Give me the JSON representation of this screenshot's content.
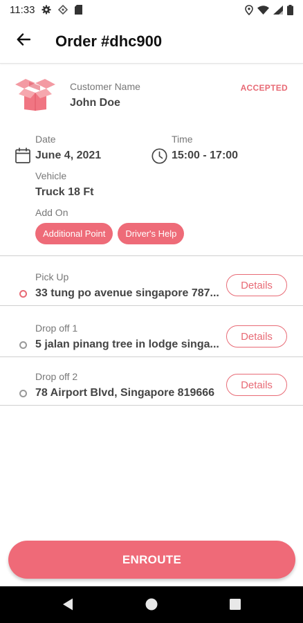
{
  "status_bar": {
    "time": "11:33",
    "icons": [
      "gear-icon",
      "location-diamond-icon",
      "sim-card-icon",
      "location-pin-icon",
      "wifi-icon",
      "signal-icon",
      "battery-icon"
    ]
  },
  "app_bar": {
    "title": "Order #dhc900",
    "back_icon": "arrow-left-icon"
  },
  "order": {
    "icon": "package-box-icon",
    "customer_label": "Customer Name",
    "customer_name": "John Doe",
    "status": "ACCEPTED",
    "date_label": "Date",
    "date": "June 4, 2021",
    "time_label": "Time",
    "time": "15:00 - 17:00",
    "vehicle_label": "Vehicle",
    "vehicle": "Truck 18 Ft",
    "addon_label": "Add On",
    "addons": [
      "Additional Point",
      "Driver's Help"
    ]
  },
  "stops": [
    {
      "label": "Pick Up",
      "address": "33 tung po avenue singapore 787...",
      "button": "Details",
      "active": true
    },
    {
      "label": "Drop off 1",
      "address": "5 jalan pinang tree in lodge singa...",
      "button": "Details",
      "active": false
    },
    {
      "label": "Drop off 2",
      "address": "78 Airport Blvd, Singapore 819666",
      "button": "Details",
      "active": false
    }
  ],
  "action": {
    "label": "ENROUTE"
  },
  "nav": {
    "icons": [
      "back-triangle-icon",
      "home-circle-icon",
      "recents-square-icon"
    ]
  },
  "colors": {
    "accent": "#ee6b78",
    "accent_text": "#e86a75",
    "text_dark": "#444444",
    "text_label": "#777777"
  }
}
